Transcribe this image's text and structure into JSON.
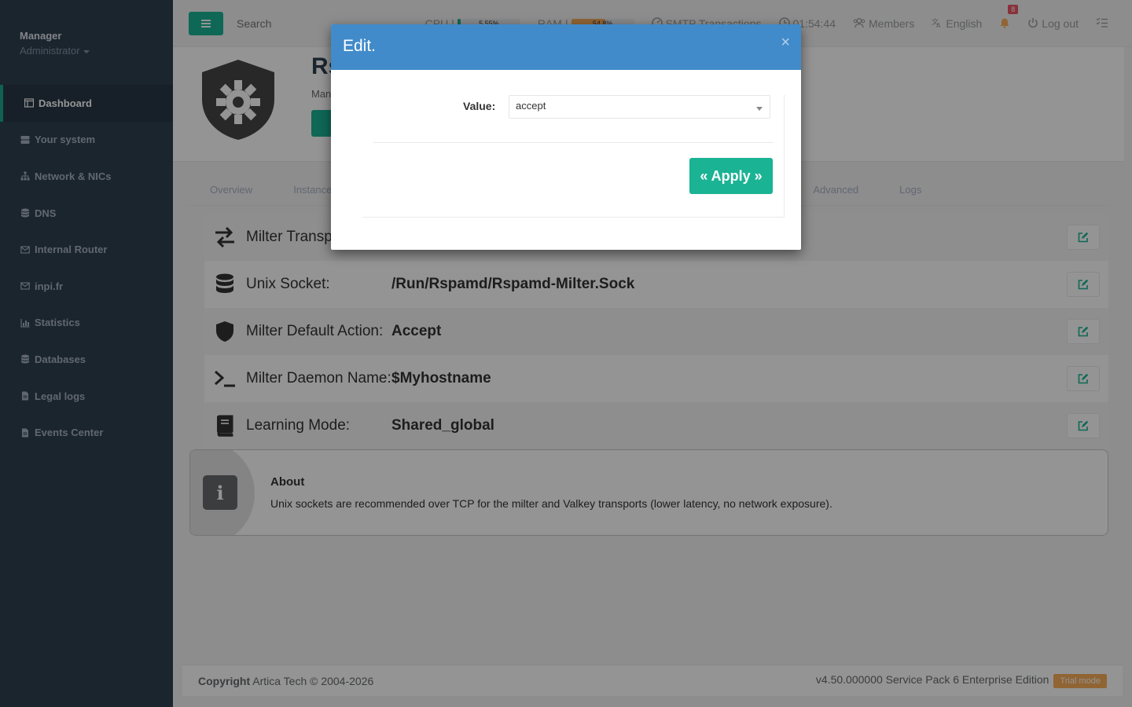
{
  "profile": {
    "name": "Manager",
    "role": "Administrator"
  },
  "sidebar": {
    "items": [
      {
        "label": "Dashboard",
        "icon": "dashboard-icon"
      },
      {
        "label": "Your system",
        "icon": "server-icon"
      },
      {
        "label": "Network & NICs",
        "icon": "sitemap-icon"
      },
      {
        "label": "DNS",
        "icon": "database-icon"
      },
      {
        "label": "Internal Router",
        "icon": "envelope-icon"
      },
      {
        "label": "inpi.fr",
        "icon": "envelope-icon"
      },
      {
        "label": "Statistics",
        "icon": "bar-chart-icon"
      },
      {
        "label": "Databases",
        "icon": "database-icon"
      },
      {
        "label": "Legal logs",
        "icon": "file-icon"
      },
      {
        "label": "Events Center",
        "icon": "file-icon"
      }
    ]
  },
  "topbar": {
    "search_placeholder": "Search",
    "cpu_label": "CPU",
    "cpu_value": "5.55%",
    "cpu_fraction": 0.0555,
    "ram_label": "RAM",
    "ram_value": "54.8%",
    "ram_fraction": 0.548,
    "smtp_label": "SMTP Transactions",
    "clock": "01:54:44",
    "members_label": "Members",
    "language_label": "English",
    "notifications_count": "8",
    "logout_label": "Log out"
  },
  "header": {
    "title": "Rs",
    "subtitle": "Man"
  },
  "tabs": [
    "Overview",
    "Instance",
    "Advanced",
    "Logs"
  ],
  "rows": [
    {
      "label": "Milter Transp",
      "value": "",
      "icon": "exchange-icon"
    },
    {
      "label": "Unix Socket:",
      "value": "/Run/Rspamd/Rspamd-Milter.Sock",
      "icon": "database-icon"
    },
    {
      "label": "Milter Default Action:",
      "value": "Accept",
      "icon": "shield-icon"
    },
    {
      "label": "Milter Daemon Name:",
      "value": "$Myhostname",
      "icon": "terminal-icon"
    },
    {
      "label": "Learning Mode:",
      "value": "Shared_global",
      "icon": "book-icon"
    }
  ],
  "about": {
    "title": "About",
    "text": "Unix sockets are recommended over TCP for the milter and Valkey transports (lower latency, no network exposure)."
  },
  "footer": {
    "copyright_strong": "Copyright",
    "copyright_rest": "Artica Tech © 2004-2026",
    "version": "v4.50.000000 Service Pack 6 Enterprise Edition",
    "trial_label": "Trial mode"
  },
  "modal": {
    "title": "Edit.",
    "close_glyph": "×",
    "value_label": "Value:",
    "selected_value": "accept",
    "apply_label": "« Apply »"
  },
  "colors": {
    "accent": "#1ab394",
    "modal_header": "#418bca",
    "sidebar_bg": "#2f4050",
    "cpu_bar": "#1ab394",
    "ram_bar": "#f8ac59",
    "badge": "#ed5565"
  }
}
